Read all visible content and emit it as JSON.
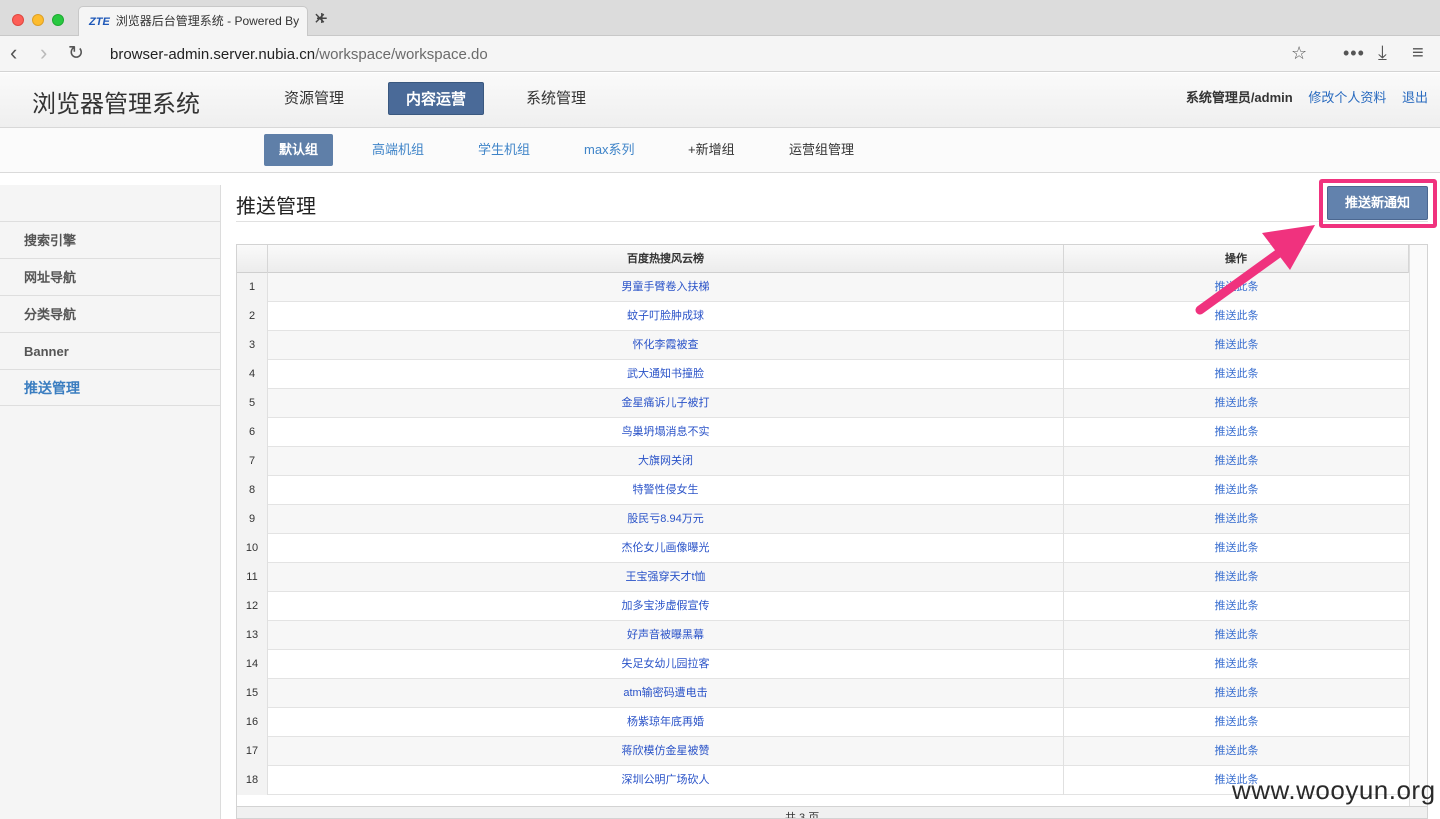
{
  "browser": {
    "tab_favicon": "ZTE",
    "tab_title": "浏览器后台管理系统 - Powered By",
    "url_host": "browser-admin.server.nubia.cn",
    "url_path": "/workspace/workspace.do"
  },
  "app": {
    "title": "浏览器管理系统",
    "main_nav": [
      "资源管理",
      "内容运营",
      "系统管理"
    ],
    "main_nav_active": "内容运营",
    "user": "系统管理员/admin",
    "profile_link": "修改个人资料",
    "logout_link": "退出"
  },
  "subnav": {
    "items": [
      "默认组",
      "高端机组",
      "学生机组",
      "max系列",
      "+新增组",
      "运营组管理"
    ],
    "active": "默认组"
  },
  "sidebar": {
    "items": [
      "搜索引擎",
      "网址导航",
      "分类导航",
      "Banner",
      "推送管理"
    ],
    "active": "推送管理"
  },
  "content": {
    "heading": "推送管理",
    "push_button": "推送新通知",
    "columns": {
      "title": "百度热搜风云榜",
      "action": "操作"
    },
    "action_label": "推送此条",
    "rows": [
      {
        "n": "1",
        "t": "男童手臂卷入扶梯"
      },
      {
        "n": "2",
        "t": "蚊子叮脸肿成球"
      },
      {
        "n": "3",
        "t": "怀化李霞被查"
      },
      {
        "n": "4",
        "t": "武大通知书撞脸"
      },
      {
        "n": "5",
        "t": "金星痛诉儿子被打"
      },
      {
        "n": "6",
        "t": "鸟巢坍塌消息不实"
      },
      {
        "n": "7",
        "t": "大旗网关闭"
      },
      {
        "n": "8",
        "t": "特警性侵女生"
      },
      {
        "n": "9",
        "t": "股民亏8.94万元"
      },
      {
        "n": "10",
        "t": "杰伦女儿画像曝光"
      },
      {
        "n": "11",
        "t": "王宝强穿天才t恤"
      },
      {
        "n": "12",
        "t": "加多宝涉虚假宣传"
      },
      {
        "n": "13",
        "t": "好声音被曝黑幕"
      },
      {
        "n": "14",
        "t": "失足女幼儿园拉客"
      },
      {
        "n": "15",
        "t": "atm输密码遭电击"
      },
      {
        "n": "16",
        "t": "杨紫琼年底再婚"
      },
      {
        "n": "17",
        "t": "蒋欣模仿金星被赞"
      },
      {
        "n": "18",
        "t": "深圳公明广场砍人"
      }
    ],
    "pager_text": "共 3 页"
  },
  "watermark": "www.wooyun.org",
  "colors": {
    "accent": "#4a6a98",
    "highlight": "#f0327e",
    "link": "#2a53c8"
  }
}
